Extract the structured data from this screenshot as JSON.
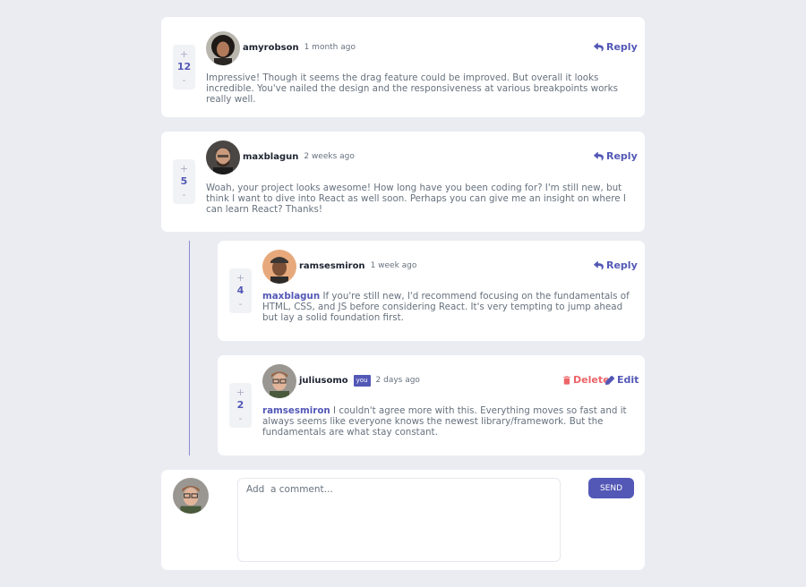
{
  "comments": [
    {
      "score": "12",
      "plus": "+",
      "minus": "-",
      "username": "amyrobson",
      "time": "1 month ago",
      "action": "Reply",
      "text": "Impressive! Though it seems the drag feature could be improved. But overall it looks incredible. You've nailed the design and the responsiveness at various breakpoints works really well."
    },
    {
      "score": "5",
      "plus": "+",
      "minus": "-",
      "username": "maxblagun",
      "time": "2 weeks ago",
      "action": "Reply",
      "text": "Woah, your project looks awesome! How long have you been coding for? I'm still new, but think I want to dive into React as well soon. Perhaps you can give me an insight on where I can learn React? Thanks!"
    }
  ],
  "replies": [
    {
      "score": "4",
      "plus": "+",
      "minus": "-",
      "username": "ramsesmiron",
      "time": "1 week ago",
      "action": "Reply",
      "mention": "maxblagun",
      "text": "If you're still new, I'd recommend focusing on the fundamentals of HTML, CSS, and JS before considering React. It's very tempting to jump ahead but lay a solid foundation first."
    },
    {
      "score": "2",
      "plus": "+",
      "minus": "-",
      "username": "juliusomo",
      "you_badge": "you",
      "time": "2 days ago",
      "delete_label": "Delete",
      "edit_label": "Edit",
      "mention": "ramsesmiron",
      "text": "I couldn't agree more with this. Everything moves so fast and it always seems like everyone knows the newest library/framework. But the fundamentals are what stay constant."
    }
  ],
  "composer": {
    "placeholder": "Add  a comment...",
    "send_label": "SEND"
  },
  "colors": {
    "accent": "#5358b6",
    "danger": "#ed6468",
    "background": "#eaecf1"
  }
}
